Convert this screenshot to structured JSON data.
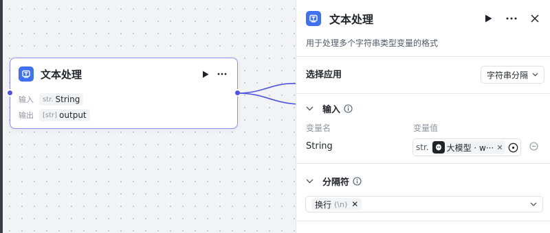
{
  "node": {
    "title": "文本处理",
    "inputs_label": "输入",
    "outputs_label": "输出",
    "input_var": {
      "type": "str.",
      "name": "String"
    },
    "output_var": {
      "type": "[str]",
      "name": "output"
    }
  },
  "panel": {
    "title": "文本处理",
    "description": "用于处理多个字符串类型变量的格式",
    "select_app_label": "选择应用",
    "select_app_value": "字符串分隔",
    "input_section": {
      "title": "输入",
      "col_name": "变量名",
      "col_value": "变量值",
      "rows": [
        {
          "name": "String",
          "type": "str.",
          "ref": "大模型 · w···"
        }
      ]
    },
    "separator_section": {
      "title": "分隔符",
      "tags": [
        {
          "label": "换行",
          "hint": "(\\n)"
        }
      ]
    }
  },
  "colors": {
    "accent": "#4d53e8",
    "node_border": "#8a8df5",
    "icon_bg": "#3f71f2"
  },
  "icons": [
    "app-icon",
    "play-icon",
    "more-icon",
    "close-icon",
    "chevron-down-icon",
    "info-icon",
    "target-icon",
    "remove-icon"
  ]
}
